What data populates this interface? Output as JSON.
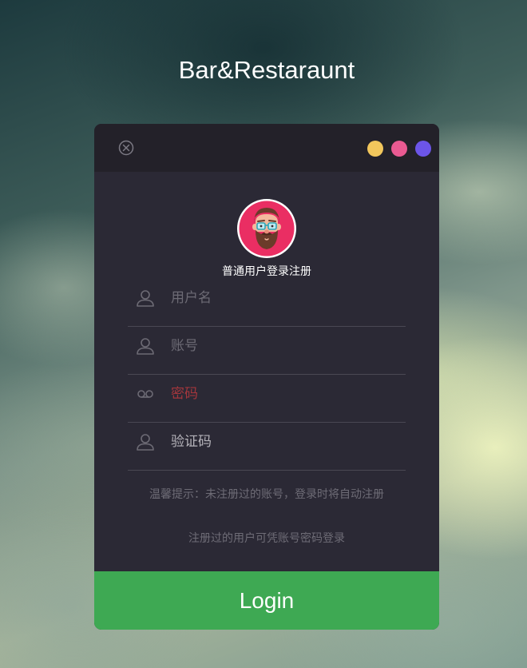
{
  "app_title": "Bar&Restaraunt",
  "window_controls": {
    "close_icon": "close-circle-icon",
    "dots": [
      {
        "name": "yellow",
        "color": "#f2c75c"
      },
      {
        "name": "pink",
        "color": "#ea5a92"
      },
      {
        "name": "purple",
        "color": "#6c55e8"
      }
    ]
  },
  "avatar": {
    "icon": "bearded-man-avatar-icon",
    "ring_color": "#ea2e63"
  },
  "subtitle": "普通用户登录注册",
  "form": {
    "fields": [
      {
        "name": "username",
        "icon": "user-icon",
        "placeholder": "用户名"
      },
      {
        "name": "account",
        "icon": "user-icon",
        "placeholder": "账号"
      },
      {
        "name": "password",
        "icon": "voicemail-icon",
        "placeholder": "密码"
      },
      {
        "name": "captcha",
        "icon": "user-icon",
        "placeholder": "验证码"
      }
    ]
  },
  "hints": {
    "tip": "温馨提示：未注册过的账号，登录时将自动注册",
    "note": "注册过的用户可凭账号密码登录"
  },
  "login_button": "Login",
  "colors": {
    "panel_bg": "#2b2935",
    "header_bg": "#232129",
    "login_green": "#3ea953"
  }
}
